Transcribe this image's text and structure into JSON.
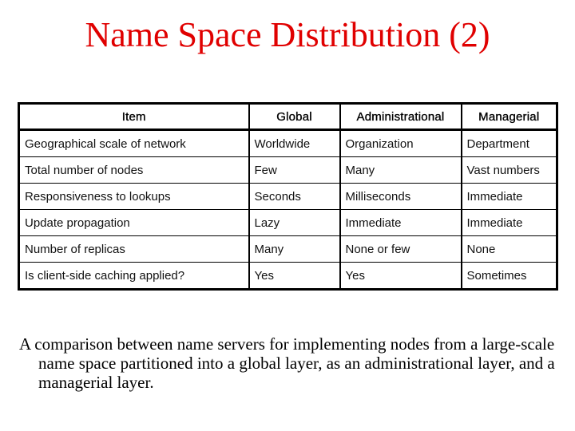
{
  "slide": {
    "title": "Name Space Distribution (2)",
    "title_color": "#e00000",
    "caption": "A comparison between name servers for implementing nodes from a large-scale name space partitioned into a global layer, as an administrational layer, and a managerial layer."
  },
  "table": {
    "headers": [
      "Item",
      "Global",
      "Administrational",
      "Managerial"
    ],
    "rows": [
      [
        "Geographical scale of network",
        "Worldwide",
        "Organization",
        "Department"
      ],
      [
        "Total number of nodes",
        "Few",
        "Many",
        "Vast numbers"
      ],
      [
        "Responsiveness to lookups",
        "Seconds",
        "Milliseconds",
        "Immediate"
      ],
      [
        "Update propagation",
        "Lazy",
        "Immediate",
        "Immediate"
      ],
      [
        "Number of replicas",
        "Many",
        "None or few",
        "None"
      ],
      [
        "Is client-side caching applied?",
        "Yes",
        "Yes",
        "Sometimes"
      ]
    ]
  }
}
